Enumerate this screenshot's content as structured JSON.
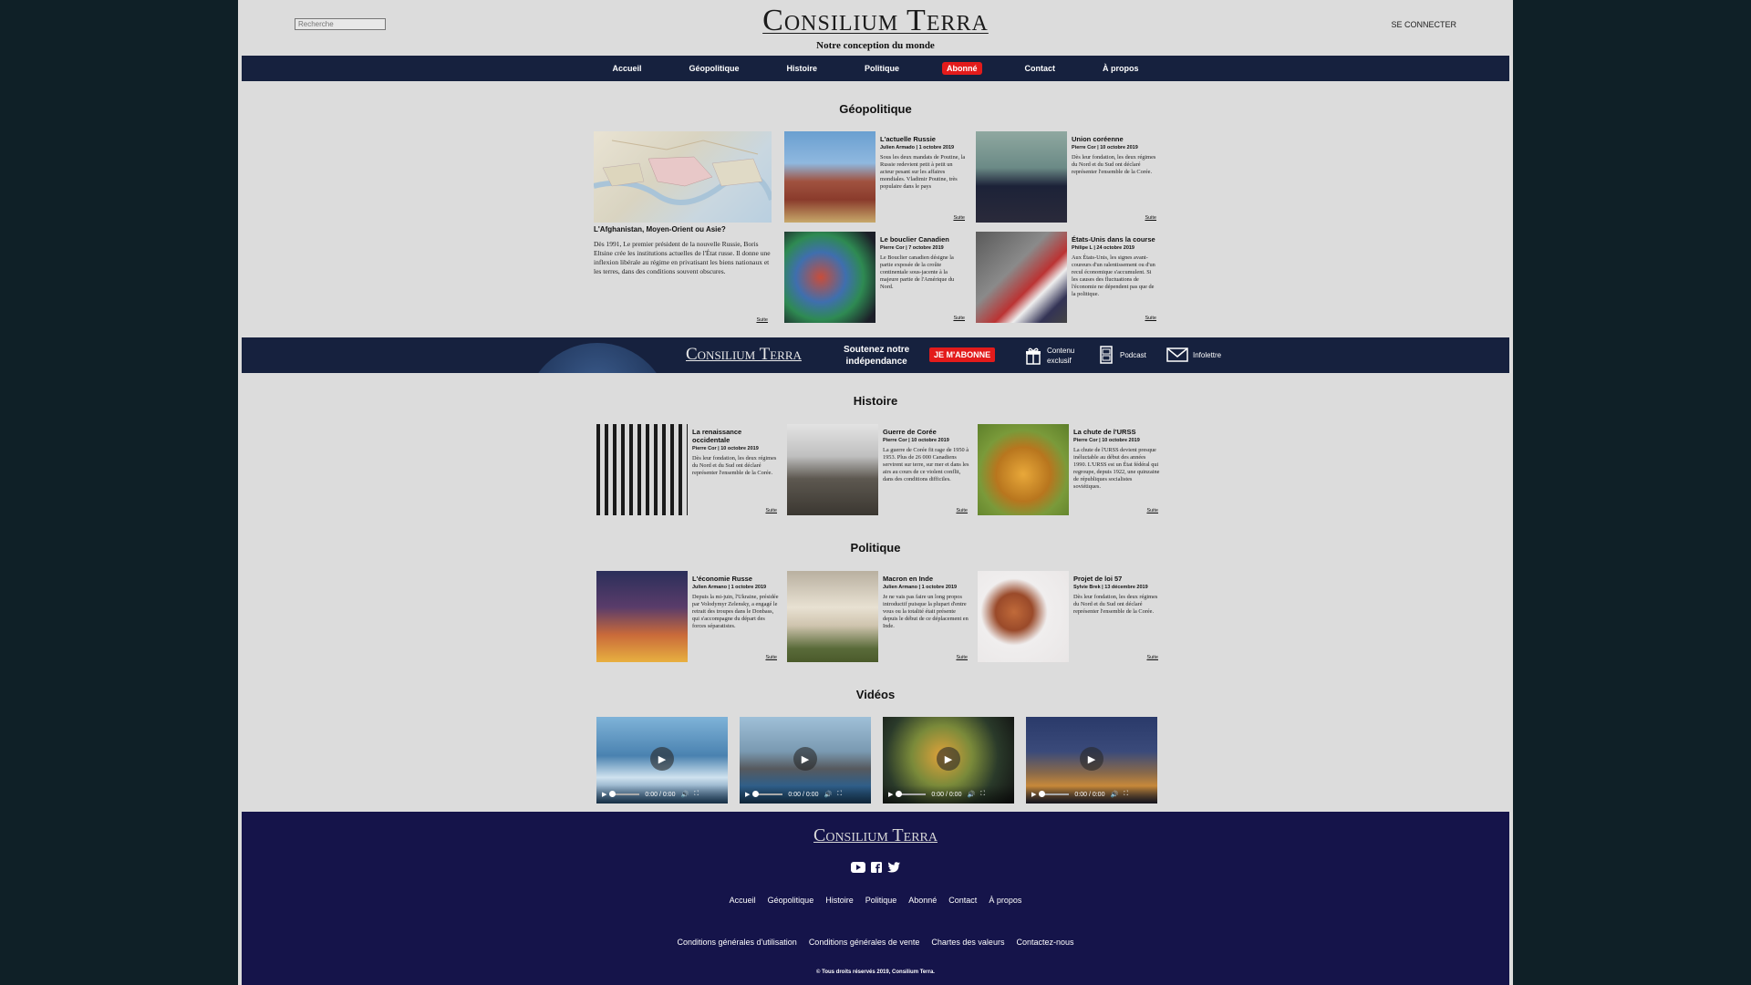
{
  "header": {
    "search_placeholder": "Recherche",
    "brand": "Consilium Terra",
    "tagline": "Notre conception du monde",
    "login": "SE CONNECTER"
  },
  "nav": [
    "Accueil",
    "Géopolitique",
    "Histoire",
    "Politique",
    "Abonné",
    "Contact",
    "À propos"
  ],
  "nav_active": "Abonné",
  "geopolitique": {
    "title": "Géopolitique",
    "featured": {
      "title": "L'Afghanistan, Moyen-Orient ou Asie?",
      "desc": "Dès 1991, Le premier président de la nouvelle Russie, Boris Eltsine crée les institutions actuelles de l'État russe. Il donne une inflexion libérale au régime en privatisant les biens nationaux et les terres, dans des conditions souvent obscures.",
      "more": "Suite"
    },
    "cards": [
      {
        "title": "L'actuelle Russie",
        "meta": "Julien Armado | 1 octobre 2019",
        "desc": "Sous les deux mandats de Poutine, la Russie redevient petit à petit un acteur pesant sur les affaires mondiales. Vladimir Poutine, très populaire dans le pays",
        "more": "Suite"
      },
      {
        "title": "Union coréenne",
        "meta": "Pierre Cor | 10 octobre 2019",
        "desc": "Dès leur fondation, les deux régimes du Nord et du Sud ont déclaré représenter l'ensemble de la Corée.",
        "more": "Suite"
      },
      {
        "title": "Le bouclier Canadien",
        "meta": "Pierre Cor | 7 octobre 2019",
        "desc": "Le Bouclier canadien désigne la partie exposée de la croûte continentale sous-jacente à la majeure partie de l'Amérique du Nord.",
        "more": "Suite"
      },
      {
        "title": "États-Unis dans la course",
        "meta": "Philipe L | 24 octobre 2019",
        "desc": "Aux États-Unis, les signes avant-coureurs d'un ralentissement ou d'un recul économique s'accumulent. Si les causes des fluctuations de l'économie ne dépendent pas que de la politique.",
        "more": "Suite"
      }
    ]
  },
  "banner": {
    "brand": "Consilium Terra",
    "support_line1": "Soutenez notre",
    "support_line2": "indépendance",
    "subscribe": "JE M'ABONNE",
    "exclusive_line1": "Contenu",
    "exclusive_line2": "exclusif",
    "podcast": "Podcast",
    "newsletter": "Infolettre"
  },
  "histoire": {
    "title": "Histoire",
    "cards": [
      {
        "title": "La renaissance occidentale",
        "meta": "Pierre Cor | 10 octobre 2019",
        "desc": "Dès leur fondation, les deux régimes du Nord et du Sud ont déclaré représenter l'ensemble de la Corée.",
        "more": "Suite"
      },
      {
        "title": "Guerre de Corée",
        "meta": "Pierre Cor | 10 octobre 2019",
        "desc": "La guerre de Corée fit rage de 1950 à 1953. Plus de 26 000 Canadiens servirent sur terre, sur mer et dans les airs au cours de ce violent conflit, dans des conditions difficiles.",
        "more": "Suite"
      },
      {
        "title": "La chute de l'URSS",
        "meta": "Pierre Cor | 10 octobre 2019",
        "desc": "La chute de l'URSS devient presque inéluctable au début des années 1990. L'URSS est un État fédéral qui regroupe, depuis 1922, une quinzaine de républiques socialistes soviétiques.",
        "more": "Suite"
      }
    ]
  },
  "politique": {
    "title": "Politique",
    "cards": [
      {
        "title": "L'économie Russe",
        "meta": "Julien Armano | 1 octobre 2019",
        "desc": "Depuis la mi-juin, l'Ukraine, présidée par Volodymyr Zelensky, a engagé le retrait des troupes dans le Donbass, qui s'accompagne du départ des forces séparatistes.",
        "more": "Suite"
      },
      {
        "title": "Macron en Inde",
        "meta": "Julien Armano | 1 octobre 2019",
        "desc": "Je ne vais pas faire un long propos introductif puisque la plupart d'entre vous ou la totalité était présente depuis le début de ce déplacement en Inde.",
        "more": "Suite"
      },
      {
        "title": "Projet de loi 57",
        "meta": "Sylvie Brek | 13 décembre 2019",
        "desc": "Dès leur fondation, les deux régimes du Nord et du Sud ont déclaré représenter l'ensemble de la Corée.",
        "more": "Suite"
      }
    ]
  },
  "videos": {
    "title": "Vidéos",
    "items": [
      {
        "time": "0:00 / 0:00"
      },
      {
        "time": "0:00 / 0:00"
      },
      {
        "time": "0:00 / 0:00"
      },
      {
        "time": "0:00 / 0:00"
      }
    ]
  },
  "footer": {
    "brand": "Consilium Terra",
    "social": [
      "youtube-icon",
      "facebook-icon",
      "twitter-icon"
    ],
    "nav": [
      "Accueil",
      "Géopolitique",
      "Histoire",
      "Politique",
      "Abonné",
      "Contact",
      "À propos"
    ],
    "legal": [
      "Conditions générales d'utilisation",
      "Conditions générales de vente",
      "Chartes des valeurs",
      "Contactez-nous"
    ],
    "copyright": "© Tous droits réservés 2019, Consilium Terra."
  },
  "colors": {
    "nav_bg": "#16213e",
    "accent": "#e31b1b",
    "footer_bg": "#15144a",
    "page_bg": "#dcdcdc"
  }
}
